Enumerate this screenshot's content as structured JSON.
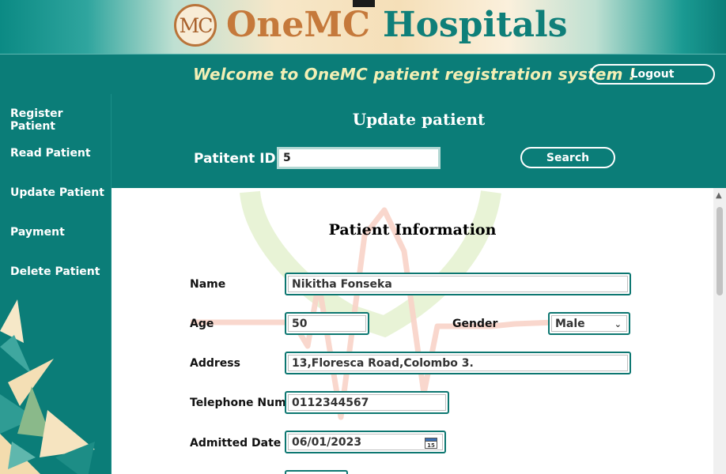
{
  "banner": {
    "logo_text": "MC",
    "brand_part1": "OneMC",
    "brand_part2": "Hospitals"
  },
  "welcome": {
    "text": "Welcome to OneMC patient registration system !",
    "logout_label": "Logout"
  },
  "sidebar": {
    "items": [
      {
        "label": "Register Patient"
      },
      {
        "label": "Read Patient"
      },
      {
        "label": "Update Patient"
      },
      {
        "label": "Payment"
      },
      {
        "label": "Delete Patient"
      }
    ]
  },
  "header": {
    "title": "Update patient",
    "patient_id_label": "Patitent ID",
    "patient_id_value": "5",
    "search_label": "Search"
  },
  "form": {
    "title": "Patient Information",
    "name_label": "Name",
    "name_value": "Nikitha Fonseka",
    "age_label": "Age",
    "age_value": "50",
    "gender_label": "Gender",
    "gender_value": "Male",
    "address_label": "Address",
    "address_value": "13,Floresca Road,Colombo 3.",
    "telephone_label": "Telephone Num",
    "telephone_value": "0112344567",
    "admitted_label": "Admitted Date",
    "admitted_value": "06/01/2023",
    "calendar_day": "15"
  },
  "colors": {
    "primary_teal": "#0b7d78",
    "brand_orange": "#c5793b",
    "welcome_yellow": "#f3efb5"
  },
  "icons": {
    "gender_dropdown": "chevron-down-icon",
    "admitted_date_picker": "calendar-icon",
    "scroll_up": "scroll-up-arrow-icon"
  }
}
